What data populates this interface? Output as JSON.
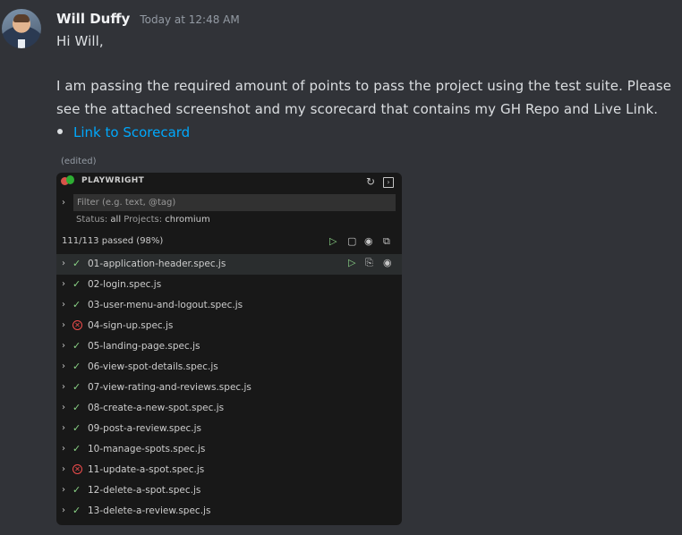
{
  "message": {
    "username": "Will Duffy",
    "timestamp": "Today at 12:48 AM",
    "lines": [
      "Hi Will,",
      "I am passing the required amount of points to pass the project using  the test suite.  Please",
      "see the attached screenshot and my scorecard that contains my GH Repo and Live Link."
    ],
    "link_text": "Link to Scorecard",
    "edited_label": "(edited)"
  },
  "playwright": {
    "title": "PLAYWRIGHT",
    "filter_placeholder": "Filter (e.g. text, @tag)",
    "status_label": "Status:",
    "status_value": "all",
    "projects_label": "Projects:",
    "projects_value": "chromium",
    "summary": "111/113 passed (98%)",
    "tests": [
      {
        "name": "01-application-header.spec.js",
        "status": "pass"
      },
      {
        "name": "02-login.spec.js",
        "status": "pass"
      },
      {
        "name": "03-user-menu-and-logout.spec.js",
        "status": "pass"
      },
      {
        "name": "04-sign-up.spec.js",
        "status": "fail"
      },
      {
        "name": "05-landing-page.spec.js",
        "status": "pass"
      },
      {
        "name": "06-view-spot-details.spec.js",
        "status": "pass"
      },
      {
        "name": "07-view-rating-and-reviews.spec.js",
        "status": "pass"
      },
      {
        "name": "08-create-a-new-spot.spec.js",
        "status": "pass"
      },
      {
        "name": "09-post-a-review.spec.js",
        "status": "pass"
      },
      {
        "name": "10-manage-spots.spec.js",
        "status": "pass"
      },
      {
        "name": "11-update-a-spot.spec.js",
        "status": "fail"
      },
      {
        "name": "12-delete-a-spot.spec.js",
        "status": "pass"
      },
      {
        "name": "13-delete-a-review.spec.js",
        "status": "pass"
      }
    ]
  },
  "icons": {
    "pass": "✓",
    "fail": "✕",
    "chevron": "›"
  },
  "colors": {
    "link": "#00a8fc",
    "pass": "#89d185",
    "fail": "#f14c4c"
  }
}
